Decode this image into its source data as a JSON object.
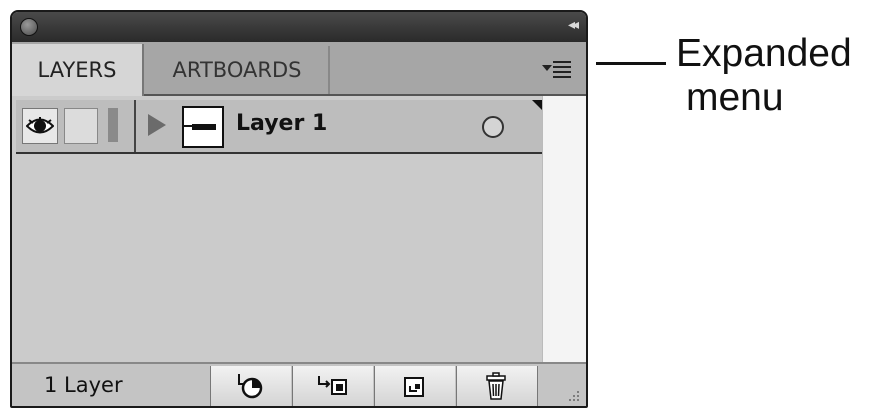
{
  "panel": {
    "tabs": [
      {
        "label": "LAYERS",
        "active": true
      },
      {
        "label": "ARTBOARDS",
        "active": false
      }
    ],
    "collapse_glyph": "◂◂",
    "layers": [
      {
        "name": "Layer 1",
        "visible": true,
        "locked": false,
        "expanded": false
      }
    ],
    "footer": {
      "count_label": "1 Layer",
      "buttons": [
        {
          "icon": "locate-object-icon"
        },
        {
          "icon": "make-clipping-mask-icon"
        },
        {
          "icon": "create-new-sublayer-icon"
        },
        {
          "icon": "trash-icon"
        }
      ]
    }
  },
  "callout": {
    "line1": "Expanded",
    "line2": "menu"
  },
  "colors": {
    "panel_bg": "#c8c8c8",
    "titlebar": "#2a2a2a",
    "selection_color_bar": "#8a8a8a"
  }
}
